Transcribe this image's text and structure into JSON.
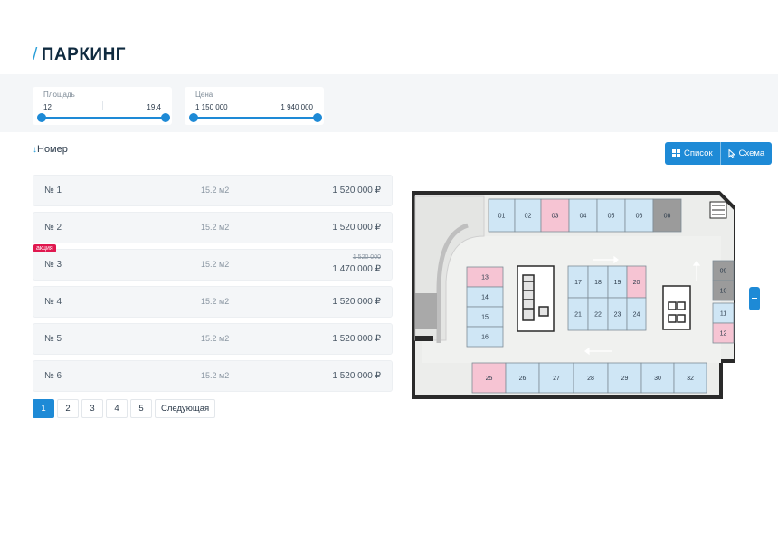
{
  "header": {
    "slash": "/",
    "title": "ПАРКИНГ"
  },
  "filters": {
    "area": {
      "label": "Площадь",
      "min": "12",
      "max": "19.4"
    },
    "price": {
      "label": "Цена",
      "min": "1 150 000",
      "max": "1 940 000"
    }
  },
  "sort": {
    "arrow": "↓",
    "label": "Номер"
  },
  "view_toggle": {
    "list_label": "Список",
    "scheme_label": "Схема"
  },
  "promo_label": "акция",
  "area_unit": "м2",
  "spots": [
    {
      "num": "№ 1",
      "area": "15.2",
      "price": "1 520 000 ₽"
    },
    {
      "num": "№ 2",
      "area": "15.2",
      "price": "1 520 000 ₽"
    },
    {
      "num": "№ 3",
      "area": "15.2",
      "price": "1 470 000 ₽",
      "old_price": "1 520 000",
      "promo": true
    },
    {
      "num": "№ 4",
      "area": "15.2",
      "price": "1 520 000 ₽"
    },
    {
      "num": "№ 5",
      "area": "15.2",
      "price": "1 520 000 ₽"
    },
    {
      "num": "№ 6",
      "area": "15.2",
      "price": "1 520 000 ₽"
    }
  ],
  "pagination": {
    "pages": [
      "1",
      "2",
      "3",
      "4",
      "5"
    ],
    "active": "1",
    "next_label": "Следующая"
  },
  "plan": {
    "spots": [
      {
        "label": "01",
        "status": "available"
      },
      {
        "label": "02",
        "status": "available"
      },
      {
        "label": "03",
        "status": "promo"
      },
      {
        "label": "04",
        "status": "available"
      },
      {
        "label": "05",
        "status": "available"
      },
      {
        "label": "06",
        "status": "available"
      },
      {
        "label": "08",
        "status": "sold"
      },
      {
        "label": "09",
        "status": "sold"
      },
      {
        "label": "10",
        "status": "sold"
      },
      {
        "label": "11",
        "status": "available"
      },
      {
        "label": "12",
        "status": "promo"
      },
      {
        "label": "13",
        "status": "promo"
      },
      {
        "label": "14",
        "status": "available"
      },
      {
        "label": "15",
        "status": "available"
      },
      {
        "label": "16",
        "status": "available"
      },
      {
        "label": "17",
        "status": "available"
      },
      {
        "label": "18",
        "status": "available"
      },
      {
        "label": "19",
        "status": "available"
      },
      {
        "label": "20",
        "status": "promo"
      },
      {
        "label": "21",
        "status": "available"
      },
      {
        "label": "22",
        "status": "available"
      },
      {
        "label": "23",
        "status": "available"
      },
      {
        "label": "24",
        "status": "available"
      },
      {
        "label": "25",
        "status": "promo"
      },
      {
        "label": "26",
        "status": "available"
      },
      {
        "label": "27",
        "status": "available"
      },
      {
        "label": "28",
        "status": "available"
      },
      {
        "label": "29",
        "status": "available"
      },
      {
        "label": "30",
        "status": "available"
      },
      {
        "label": "32",
        "status": "available"
      }
    ]
  },
  "colors": {
    "accent": "#1e8ad6",
    "available": "#cfe6f5",
    "promo": "#f6c4d3",
    "sold": "#9b9b9b",
    "promo_badge": "#e0184f"
  }
}
